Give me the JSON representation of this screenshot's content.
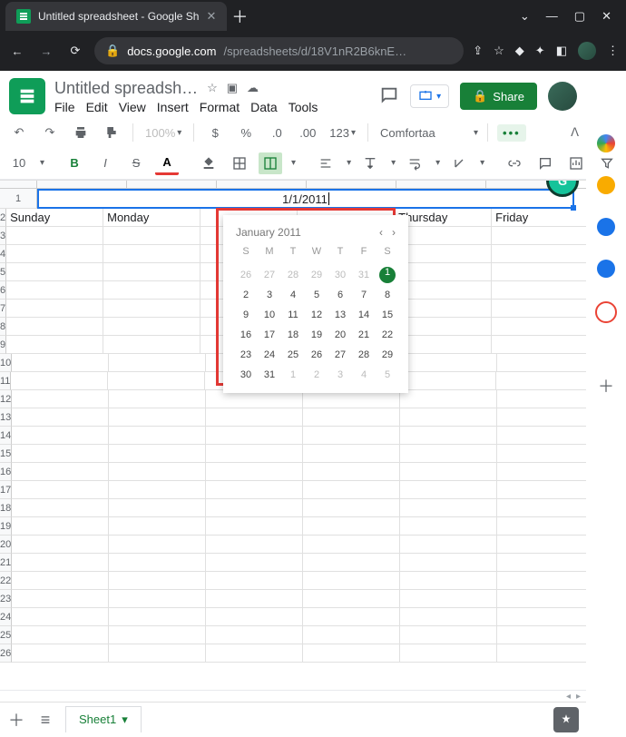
{
  "browser": {
    "tab_title": "Untitled spreadsheet - Google Sh",
    "url_host": "docs.google.com",
    "url_path": "/spreadsheets/d/18V1nR2B6knE…"
  },
  "doc": {
    "title": "Untitled spreadsh…",
    "menu": [
      "File",
      "Edit",
      "View",
      "Insert",
      "Format",
      "Data",
      "Tools"
    ]
  },
  "header": {
    "share_label": "Share"
  },
  "toolbar1": {
    "zoom": "100%",
    "currency": "$",
    "percent": "%",
    "dec_dec": ".0",
    "inc_dec": ".00",
    "more_fmt": "123",
    "font": "Comfortaa",
    "more": "•••"
  },
  "toolbar2": {
    "font_size": "10",
    "bold": "B",
    "italic": "I",
    "strike": "S",
    "underlineA": "A"
  },
  "grid": {
    "row1_value": "1/1/2011",
    "row2": [
      "Sunday",
      "Monday",
      "",
      "",
      "Thursday",
      "Friday"
    ],
    "row_count": 26,
    "col_count": 6
  },
  "calendar": {
    "title": "January 2011",
    "dow": [
      "S",
      "M",
      "T",
      "W",
      "T",
      "F",
      "S"
    ],
    "weeks": [
      [
        {
          "n": 26,
          "m": true
        },
        {
          "n": 27,
          "m": true
        },
        {
          "n": 28,
          "m": true
        },
        {
          "n": 29,
          "m": true
        },
        {
          "n": 30,
          "m": true
        },
        {
          "n": 31,
          "m": true
        },
        {
          "n": 1,
          "sel": true
        }
      ],
      [
        {
          "n": 2
        },
        {
          "n": 3
        },
        {
          "n": 4
        },
        {
          "n": 5
        },
        {
          "n": 6
        },
        {
          "n": 7
        },
        {
          "n": 8
        }
      ],
      [
        {
          "n": 9
        },
        {
          "n": 10
        },
        {
          "n": 11
        },
        {
          "n": 12
        },
        {
          "n": 13
        },
        {
          "n": 14
        },
        {
          "n": 15
        }
      ],
      [
        {
          "n": 16
        },
        {
          "n": 17
        },
        {
          "n": 18
        },
        {
          "n": 19
        },
        {
          "n": 20
        },
        {
          "n": 21
        },
        {
          "n": 22
        }
      ],
      [
        {
          "n": 23
        },
        {
          "n": 24
        },
        {
          "n": 25
        },
        {
          "n": 26
        },
        {
          "n": 27
        },
        {
          "n": 28
        },
        {
          "n": 29
        }
      ],
      [
        {
          "n": 30
        },
        {
          "n": 31
        },
        {
          "n": 1,
          "m": true
        },
        {
          "n": 2,
          "m": true
        },
        {
          "n": 3,
          "m": true
        },
        {
          "n": 4,
          "m": true
        },
        {
          "n": 5,
          "m": true
        }
      ]
    ]
  },
  "sheets": {
    "active": "Sheet1"
  },
  "sidepanel_colors": [
    "#f4b400",
    "#f9ab00",
    "#1a73e8",
    "#1a73e8",
    "#ea4335"
  ]
}
